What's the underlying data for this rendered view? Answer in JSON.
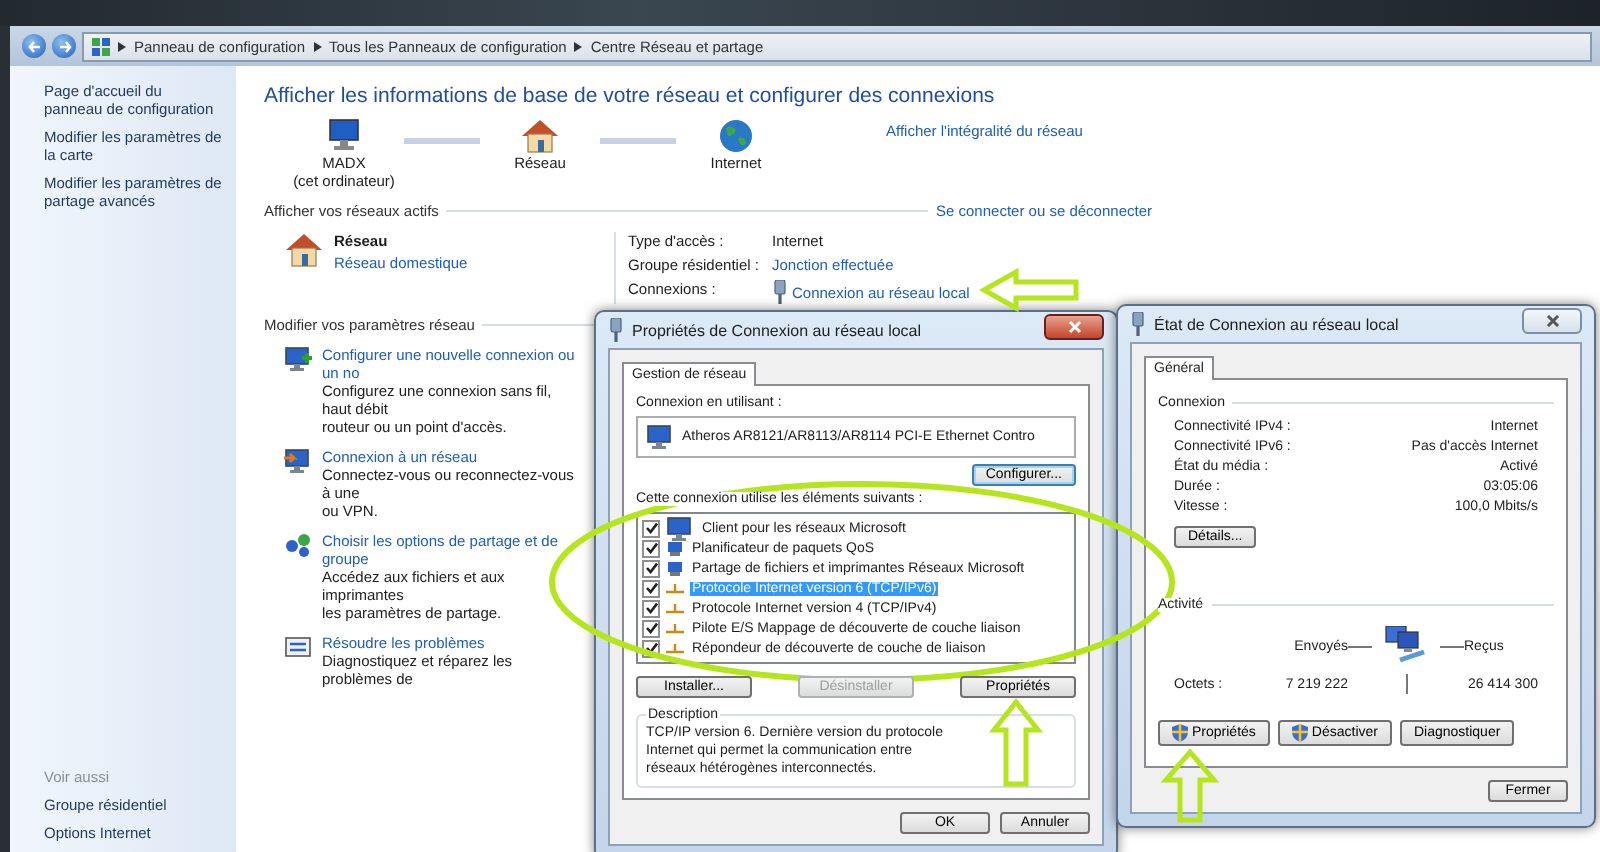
{
  "address_bar": {
    "breadcrumbs": [
      "Panneau de configuration",
      "Tous les Panneaux de configuration",
      "Centre Réseau et partage"
    ]
  },
  "sidebar": {
    "links": [
      "Page d'accueil du panneau de configuration",
      "Modifier les paramètres de la carte",
      "Modifier les paramètres de partage avancés"
    ],
    "see_also_title": "Voir aussi",
    "see_also": [
      "Groupe résidentiel",
      "Options Internet"
    ]
  },
  "main": {
    "title": "Afficher les informations de base de votre réseau et configurer des connexions",
    "map": {
      "nodes": [
        {
          "kind": "computer",
          "label": "MADX",
          "sublabel": "(cet ordinateur)"
        },
        {
          "kind": "house",
          "label": "Réseau"
        },
        {
          "kind": "globe",
          "label": "Internet"
        }
      ],
      "full_map_link": "Afficher l'intégralité du réseau"
    },
    "active_networks": {
      "heading": "Afficher vos réseaux actifs",
      "link": "Se connecter ou se déconnecter",
      "network": {
        "name": "Réseau",
        "type": "Réseau domestique"
      },
      "details": [
        {
          "label": "Type d'accès :",
          "value": "Internet",
          "kind": "text"
        },
        {
          "label": "Groupe résidentiel :",
          "value": "Jonction effectuée",
          "kind": "link"
        },
        {
          "label": "Connexions :",
          "value": "Connexion au réseau local",
          "kind": "connection"
        }
      ]
    },
    "settings": {
      "heading": "Modifier vos paramètres réseau",
      "tasks": [
        {
          "kind": "new-connection",
          "title": "Configurer une nouvelle connexion ou un no",
          "description_lines": [
            "Configurez une connexion sans fil, haut débit",
            "routeur ou un point d'accès."
          ]
        },
        {
          "kind": "connect",
          "title": "Connexion à un réseau",
          "description_lines": [
            "Connectez-vous ou reconnectez-vous à une",
            "ou VPN."
          ]
        },
        {
          "kind": "sharing",
          "title": "Choisir les options de partage et de groupe",
          "description_lines": [
            "Accédez aux fichiers et aux imprimantes",
            "les paramètres de partage."
          ]
        },
        {
          "kind": "troubleshoot",
          "title": "Résoudre les problèmes",
          "description_lines": [
            "Diagnostiquez et réparez les problèmes de"
          ]
        }
      ]
    }
  },
  "dialog_properties": {
    "title": "Propriétés de Connexion au réseau local",
    "tab": "Gestion de réseau",
    "adapter_label": "Connexion en utilisant :",
    "adapter": "Atheros AR8121/AR8113/AR8114 PCI-E Ethernet Contro",
    "configure_button": "Configurer...",
    "items_label": "Cette connexion utilise les éléments suivants :",
    "items": [
      {
        "kind": "client",
        "label": "Client pour les réseaux Microsoft",
        "checked": true,
        "selected": false
      },
      {
        "kind": "service",
        "label": "Planificateur de paquets QoS",
        "checked": true,
        "selected": false
      },
      {
        "kind": "service",
        "label": "Partage de fichiers et imprimantes Réseaux Microsoft",
        "checked": true,
        "selected": false
      },
      {
        "kind": "protocol",
        "label": "Protocole Internet version 6 (TCP/IPv6)",
        "checked": true,
        "selected": true
      },
      {
        "kind": "protocol",
        "label": "Protocole Internet version 4 (TCP/IPv4)",
        "checked": true,
        "selected": false
      },
      {
        "kind": "protocol",
        "label": "Pilote E/S Mappage de découverte de couche liaison",
        "checked": true,
        "selected": false
      },
      {
        "kind": "protocol",
        "label": "Répondeur de découverte de couche de liaison",
        "checked": true,
        "selected": false
      }
    ],
    "buttons": [
      {
        "label": "Installer...",
        "disabled": false
      },
      {
        "label": "Désinstaller",
        "disabled": true
      },
      {
        "label": "Propriétés",
        "disabled": false
      }
    ],
    "description_title": "Description",
    "description": "TCP/IP version 6. Dernière version du protocole Internet qui permet la communication entre réseaux hétérogènes interconnectés.",
    "ok_button": "OK",
    "cancel_button": "Annuler"
  },
  "dialog_status": {
    "title": "État de Connexion au réseau local",
    "tab": "Général",
    "connection_heading": "Connexion",
    "rows": [
      {
        "label": "Connectivité IPv4 :",
        "value": "Internet"
      },
      {
        "label": "Connectivité IPv6 :",
        "value": "Pas d'accès Internet"
      },
      {
        "label": "État du média :",
        "value": "Activé"
      },
      {
        "label": "Durée :",
        "value": "03:05:06"
      },
      {
        "label": "Vitesse :",
        "value": "100,0 Mbits/s"
      }
    ],
    "details_button": "Détails...",
    "activity_heading": "Activité",
    "sent_label": "Envoyés",
    "received_label": "Reçus",
    "bytes_label": "Octets :",
    "sent": "7 219 222",
    "received": "26 414 300",
    "buttons": [
      {
        "label": "Propriétés",
        "shield": true
      },
      {
        "label": "Désactiver",
        "shield": true
      },
      {
        "label": "Diagnostiquer",
        "shield": false
      }
    ],
    "close_button": "Fermer"
  }
}
